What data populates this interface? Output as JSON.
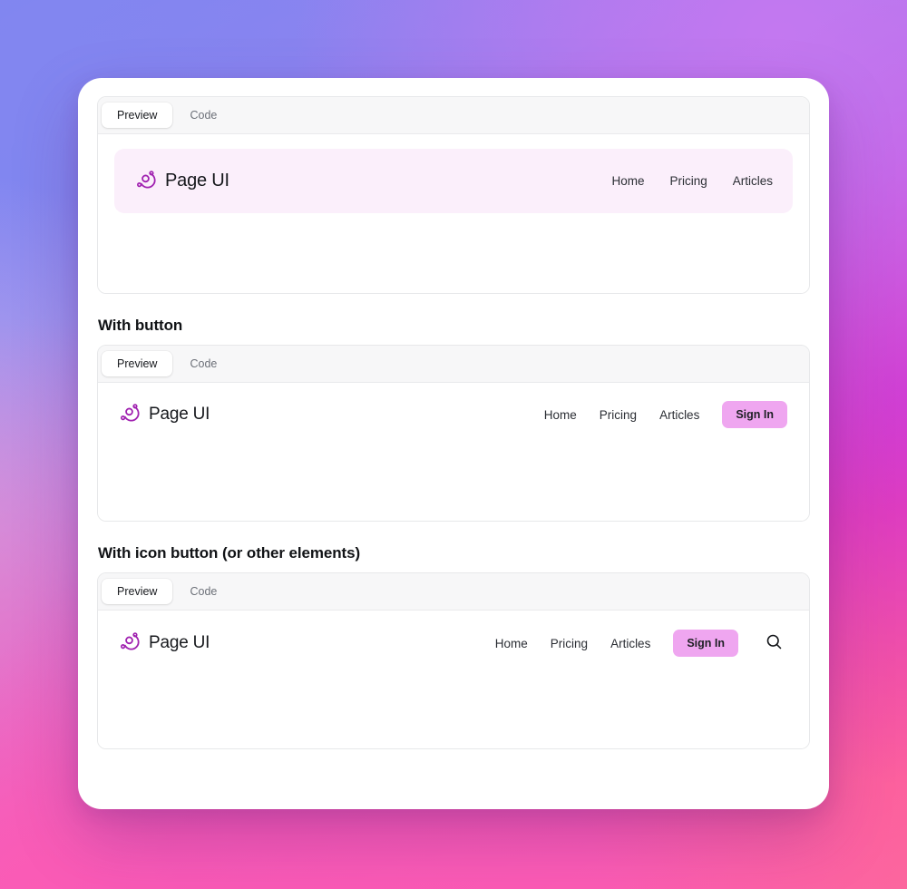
{
  "theme": {
    "accent": "#efa6f0",
    "logo_color": "#a021b0",
    "tinted_nav_bg": "#fbeffb",
    "heading_color": "#111316",
    "tabbar_bg": "#f7f7f8"
  },
  "sections": [
    {
      "id": "basic",
      "heading": "",
      "tabs": [
        {
          "label": "Preview",
          "active": true
        },
        {
          "label": "Code",
          "active": false
        }
      ],
      "navbar": {
        "brand": {
          "icon": "orbit-logo-icon",
          "name": "Page UI"
        },
        "links": [
          "Home",
          "Pricing",
          "Articles"
        ],
        "button": null,
        "icon_button": null
      }
    },
    {
      "id": "button",
      "heading": "With button",
      "tabs": [
        {
          "label": "Preview",
          "active": true
        },
        {
          "label": "Code",
          "active": false
        }
      ],
      "navbar": {
        "brand": {
          "icon": "orbit-logo-icon",
          "name": "Page UI"
        },
        "links": [
          "Home",
          "Pricing",
          "Articles"
        ],
        "button": "Sign In",
        "icon_button": null
      }
    },
    {
      "id": "iconbutton",
      "heading": "With icon button (or other elements)",
      "tabs": [
        {
          "label": "Preview",
          "active": true
        },
        {
          "label": "Code",
          "active": false
        }
      ],
      "navbar": {
        "brand": {
          "icon": "orbit-logo-icon",
          "name": "Page UI"
        },
        "links": [
          "Home",
          "Pricing",
          "Articles"
        ],
        "button": "Sign In",
        "icon_button": "search-icon"
      }
    }
  ]
}
